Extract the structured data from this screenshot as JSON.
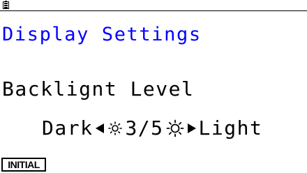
{
  "status": {
    "battery_icon": "battery-icon"
  },
  "title": "Display Settings",
  "setting": {
    "label": "Backlignt Level",
    "min_label": "Dark",
    "max_label": "Light",
    "value_text": "3/5",
    "value": 3,
    "max": 5,
    "left_arrow_icon": "triangle-left-icon",
    "right_arrow_icon": "triangle-right-icon",
    "dim_icon": "sun-small-icon",
    "bright_icon": "sun-large-icon"
  },
  "softkeys": [
    {
      "label": "INITIAL"
    }
  ],
  "colors": {
    "title": "#0000ff",
    "text": "#000000",
    "background": "#ffffff"
  }
}
